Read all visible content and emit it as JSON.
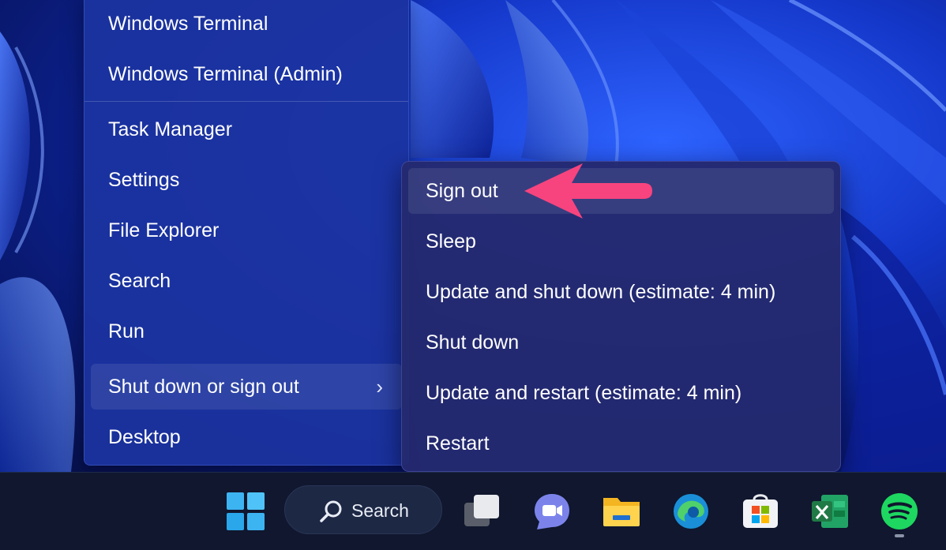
{
  "main_menu": {
    "items": [
      {
        "label": "Windows Terminal"
      },
      {
        "label": "Windows Terminal (Admin)"
      },
      {
        "label": "Task Manager"
      },
      {
        "label": "Settings"
      },
      {
        "label": "File Explorer"
      },
      {
        "label": "Search"
      },
      {
        "label": "Run"
      },
      {
        "label": "Shut down or sign out",
        "chevron": "›"
      },
      {
        "label": "Desktop"
      }
    ]
  },
  "submenu": {
    "items": [
      {
        "label": "Sign out"
      },
      {
        "label": "Sleep"
      },
      {
        "label": "Update and shut down (estimate: 4 min)"
      },
      {
        "label": "Shut down"
      },
      {
        "label": "Update and restart (estimate: 4 min)"
      },
      {
        "label": "Restart"
      }
    ]
  },
  "annotation": {
    "color": "#f7447e",
    "icon": "arrow-pointing-left"
  },
  "taskbar": {
    "search_label": "Search",
    "icons": [
      "windows-start-icon",
      "search-icon",
      "task-view-icon",
      "teams-chat-icon",
      "file-explorer-icon",
      "edge-icon",
      "microsoft-store-icon",
      "excel-icon",
      "spotify-icon"
    ]
  },
  "colors": {
    "accent": "#1c34a0",
    "taskbar": "#10172e",
    "start_blue": "#3db4f2",
    "spotify": "#1ed760",
    "excel": "#1f7a45"
  }
}
